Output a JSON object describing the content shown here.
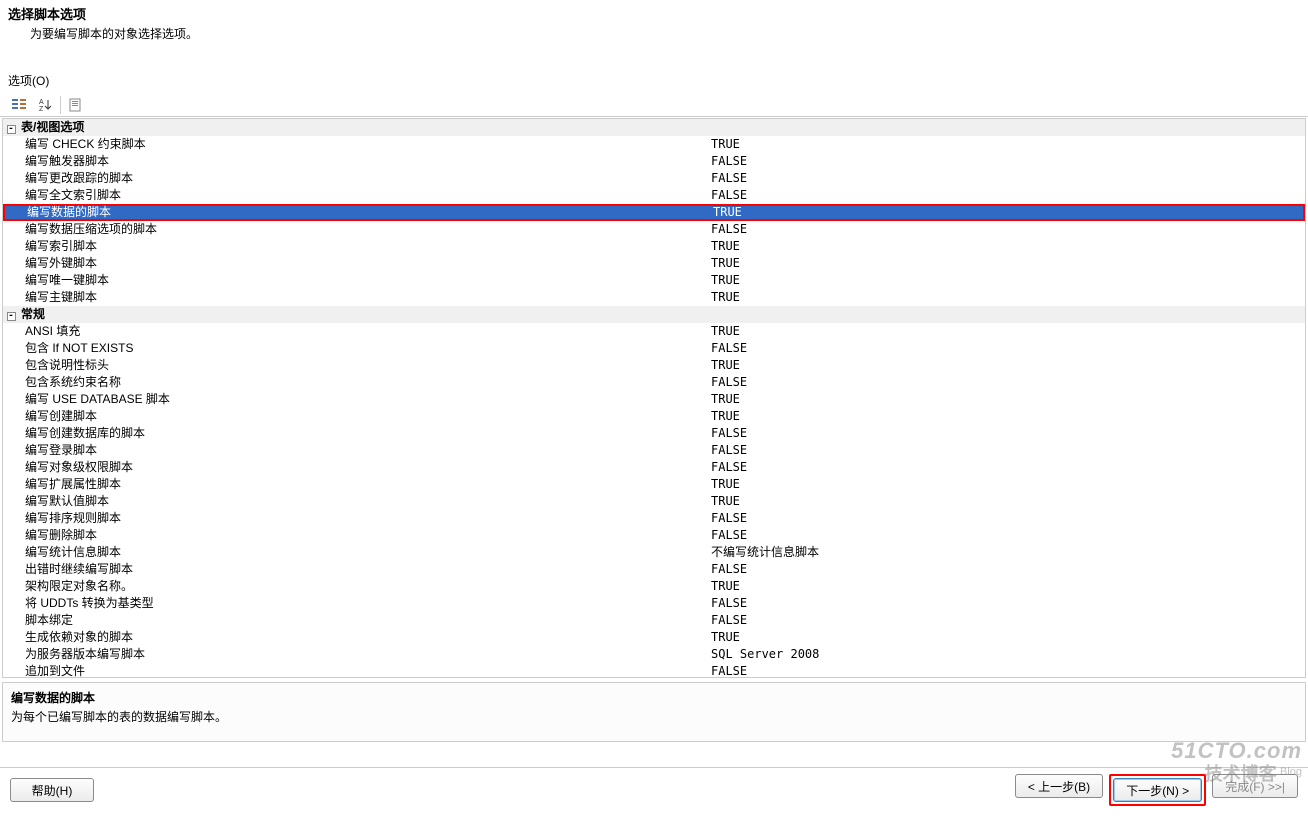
{
  "header": {
    "title": "选择脚本选项",
    "subtitle": "为要编写脚本的对象选择选项。"
  },
  "options_label": "选项(O)",
  "categories": [
    {
      "name": "表/视图选项",
      "rows": [
        {
          "label": "编写 CHECK 约束脚本",
          "value": "TRUE"
        },
        {
          "label": "编写触发器脚本",
          "value": "FALSE"
        },
        {
          "label": "编写更改跟踪的脚本",
          "value": "FALSE"
        },
        {
          "label": "编写全文索引脚本",
          "value": "FALSE"
        },
        {
          "label": "编写数据的脚本",
          "value": "TRUE",
          "selected": true,
          "highlight": true
        },
        {
          "label": "编写数据压缩选项的脚本",
          "value": "FALSE"
        },
        {
          "label": "编写索引脚本",
          "value": "TRUE"
        },
        {
          "label": "编写外键脚本",
          "value": "TRUE"
        },
        {
          "label": "编写唯一键脚本",
          "value": "TRUE"
        },
        {
          "label": "编写主键脚本",
          "value": "TRUE"
        }
      ]
    },
    {
      "name": "常规",
      "rows": [
        {
          "label": "ANSI 填充",
          "value": "TRUE"
        },
        {
          "label": "包含 If NOT EXISTS",
          "value": "FALSE"
        },
        {
          "label": "包含说明性标头",
          "value": "TRUE"
        },
        {
          "label": "包含系统约束名称",
          "value": "FALSE"
        },
        {
          "label": "编写 USE DATABASE 脚本",
          "value": "TRUE"
        },
        {
          "label": "编写创建脚本",
          "value": "TRUE"
        },
        {
          "label": "编写创建数据库的脚本",
          "value": "FALSE"
        },
        {
          "label": "编写登录脚本",
          "value": "FALSE"
        },
        {
          "label": "编写对象级权限脚本",
          "value": "FALSE"
        },
        {
          "label": "编写扩展属性脚本",
          "value": "TRUE"
        },
        {
          "label": "编写默认值脚本",
          "value": "TRUE"
        },
        {
          "label": "编写排序规则脚本",
          "value": "FALSE"
        },
        {
          "label": "编写删除脚本",
          "value": "FALSE"
        },
        {
          "label": "编写统计信息脚本",
          "value": "不编写统计信息脚本"
        },
        {
          "label": "出错时继续编写脚本",
          "value": "FALSE"
        },
        {
          "label": "架构限定对象名称。",
          "value": "TRUE"
        },
        {
          "label": "将 UDDTs 转换为基类型",
          "value": "FALSE"
        },
        {
          "label": "脚本绑定",
          "value": "FALSE"
        },
        {
          "label": "生成依赖对象的脚本",
          "value": "TRUE"
        },
        {
          "label": "为服务器版本编写脚本",
          "value": "SQL Server 2008"
        },
        {
          "label": "追加到文件",
          "value": "FALSE"
        }
      ]
    }
  ],
  "description": {
    "title": "编写数据的脚本",
    "text": "为每个已编写脚本的表的数据编写脚本。"
  },
  "buttons": {
    "help": "帮助(H)",
    "back": "< 上一步(B)",
    "next": "下一步(N) >",
    "finish": "完成(F) >>|"
  },
  "watermark": {
    "line1": "51CTO.com",
    "line2": "技术博客",
    "blog": "Blog"
  }
}
